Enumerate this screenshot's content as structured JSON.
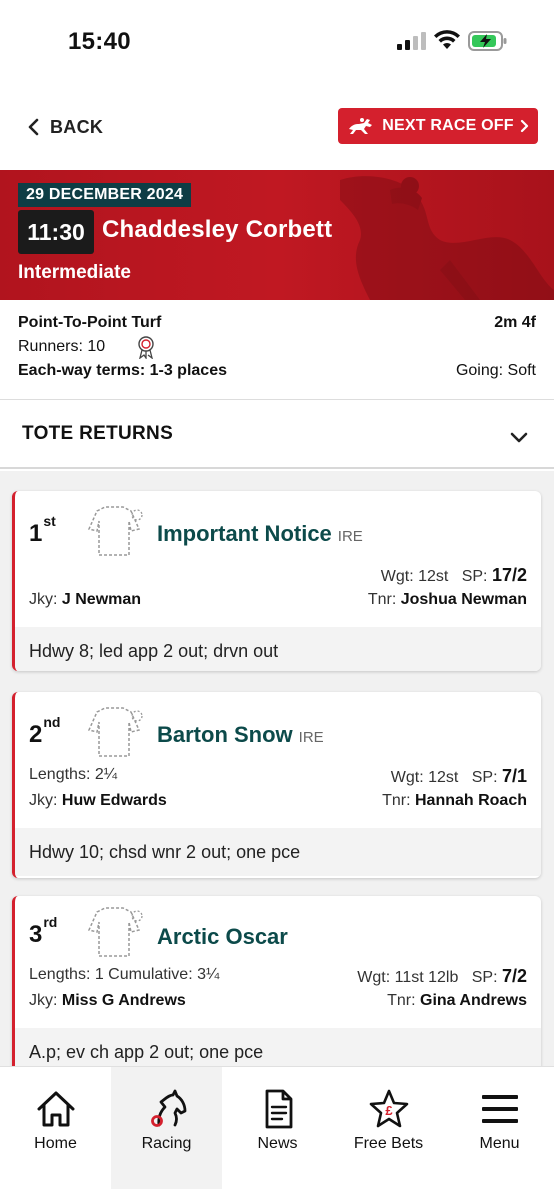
{
  "status_bar": {
    "time": "15:40"
  },
  "nav": {
    "back_label": "BACK",
    "next_race_label": "NEXT RACE OFF"
  },
  "race": {
    "date": "29 DECEMBER 2024",
    "time": "11:30",
    "course": "Chaddesley Corbett",
    "class": "Intermediate",
    "type": "Point-To-Point Turf",
    "distance": "2m 4f",
    "runners_label": "Runners: 10",
    "each_way": "Each-way terms: 1-3 places",
    "going": "Going: Soft"
  },
  "tote": {
    "label": "TOTE RETURNS"
  },
  "results": [
    {
      "position": "1",
      "suffix": "st",
      "horse": "Important Notice",
      "country": "IRE",
      "lengths": "",
      "wgt_label": "Wgt:",
      "weight": "12st",
      "sp_label": "SP:",
      "sp": "17/2",
      "jky_label": "Jky:",
      "jockey": "J Newman",
      "tnr_label": "Tnr:",
      "trainer": "Joshua Newman",
      "comment": "Hdwy 8; led app 2 out; drvn out"
    },
    {
      "position": "2",
      "suffix": "nd",
      "horse": "Barton Snow",
      "country": "IRE",
      "lengths": "Lengths: 2¼",
      "wgt_label": "Wgt:",
      "weight": "12st",
      "sp_label": "SP:",
      "sp": "7/1",
      "jky_label": "Jky:",
      "jockey": "Huw Edwards",
      "tnr_label": "Tnr:",
      "trainer": "Hannah Roach",
      "comment": "Hdwy 10; chsd wnr 2 out; one pce"
    },
    {
      "position": "3",
      "suffix": "rd",
      "horse": "Arctic Oscar",
      "country": "",
      "lengths": "Lengths: 1 Cumulative: 3¼",
      "wgt_label": "Wgt:",
      "weight": "11st 12lb",
      "sp_label": "SP:",
      "sp": "7/2",
      "jky_label": "Jky:",
      "jockey": "Miss G Andrews",
      "tnr_label": "Tnr:",
      "trainer": "Gina Andrews",
      "comment": "A.p; ev ch app 2 out; one pce"
    }
  ],
  "bottom_nav": {
    "items": [
      {
        "label": "Home",
        "icon": "home-icon"
      },
      {
        "label": "Racing",
        "icon": "horse-head-icon"
      },
      {
        "label": "News",
        "icon": "document-icon"
      },
      {
        "label": "Free Bets",
        "icon": "star-pound-icon"
      },
      {
        "label": "Menu",
        "icon": "hamburger-icon"
      }
    ],
    "active": "Racing"
  },
  "colors": {
    "brand_red": "#d4202d",
    "date_badge": "#0e3d45",
    "horse_name": "#0c4a4a"
  }
}
